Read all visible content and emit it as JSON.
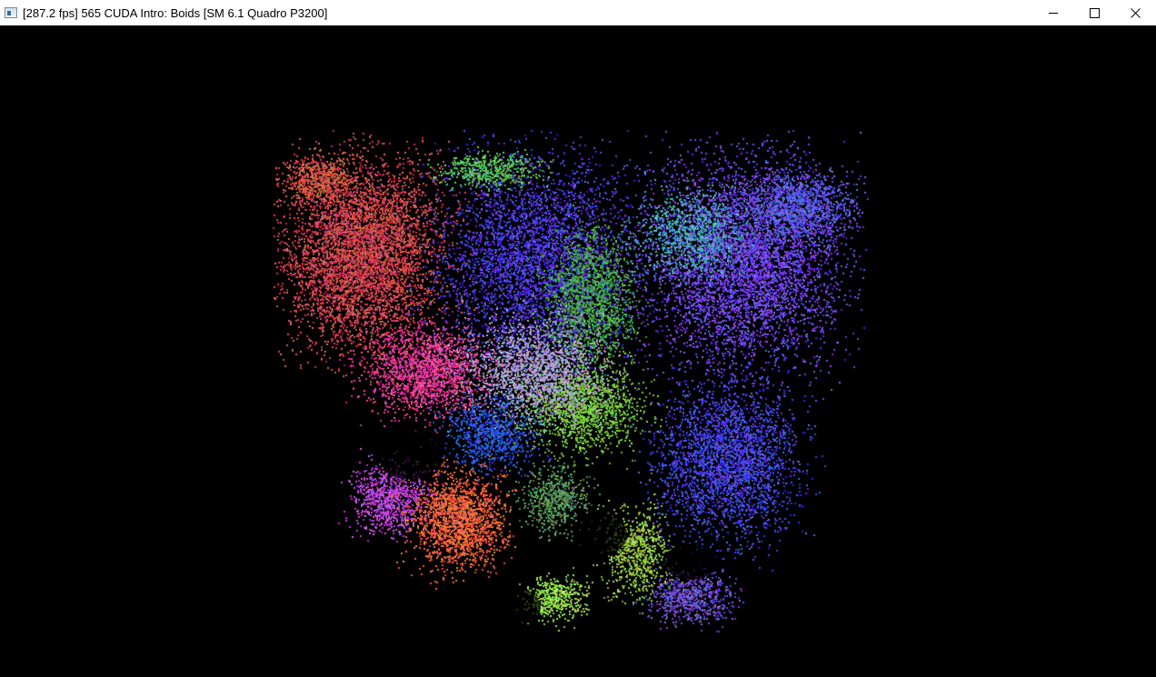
{
  "window": {
    "title": "[287.2 fps] 565 CUDA Intro: Boids [SM 6.1 Quadro P3200]",
    "icon": "app-window-icon",
    "controls": {
      "minimize_icon": "minimize-icon",
      "maximize_icon": "maximize-icon",
      "close_icon": "close-icon"
    }
  },
  "viewport": {
    "background": "#000000",
    "content": "boids-particle-simulation",
    "palette": [
      "#d94a4a",
      "#5a3ae8",
      "#3b3be0",
      "#e84aa8",
      "#ff6a3a",
      "#7ad94a",
      "#3ad9a0",
      "#9a3ae8",
      "#c84a9a",
      "#4a8ae8"
    ]
  }
}
